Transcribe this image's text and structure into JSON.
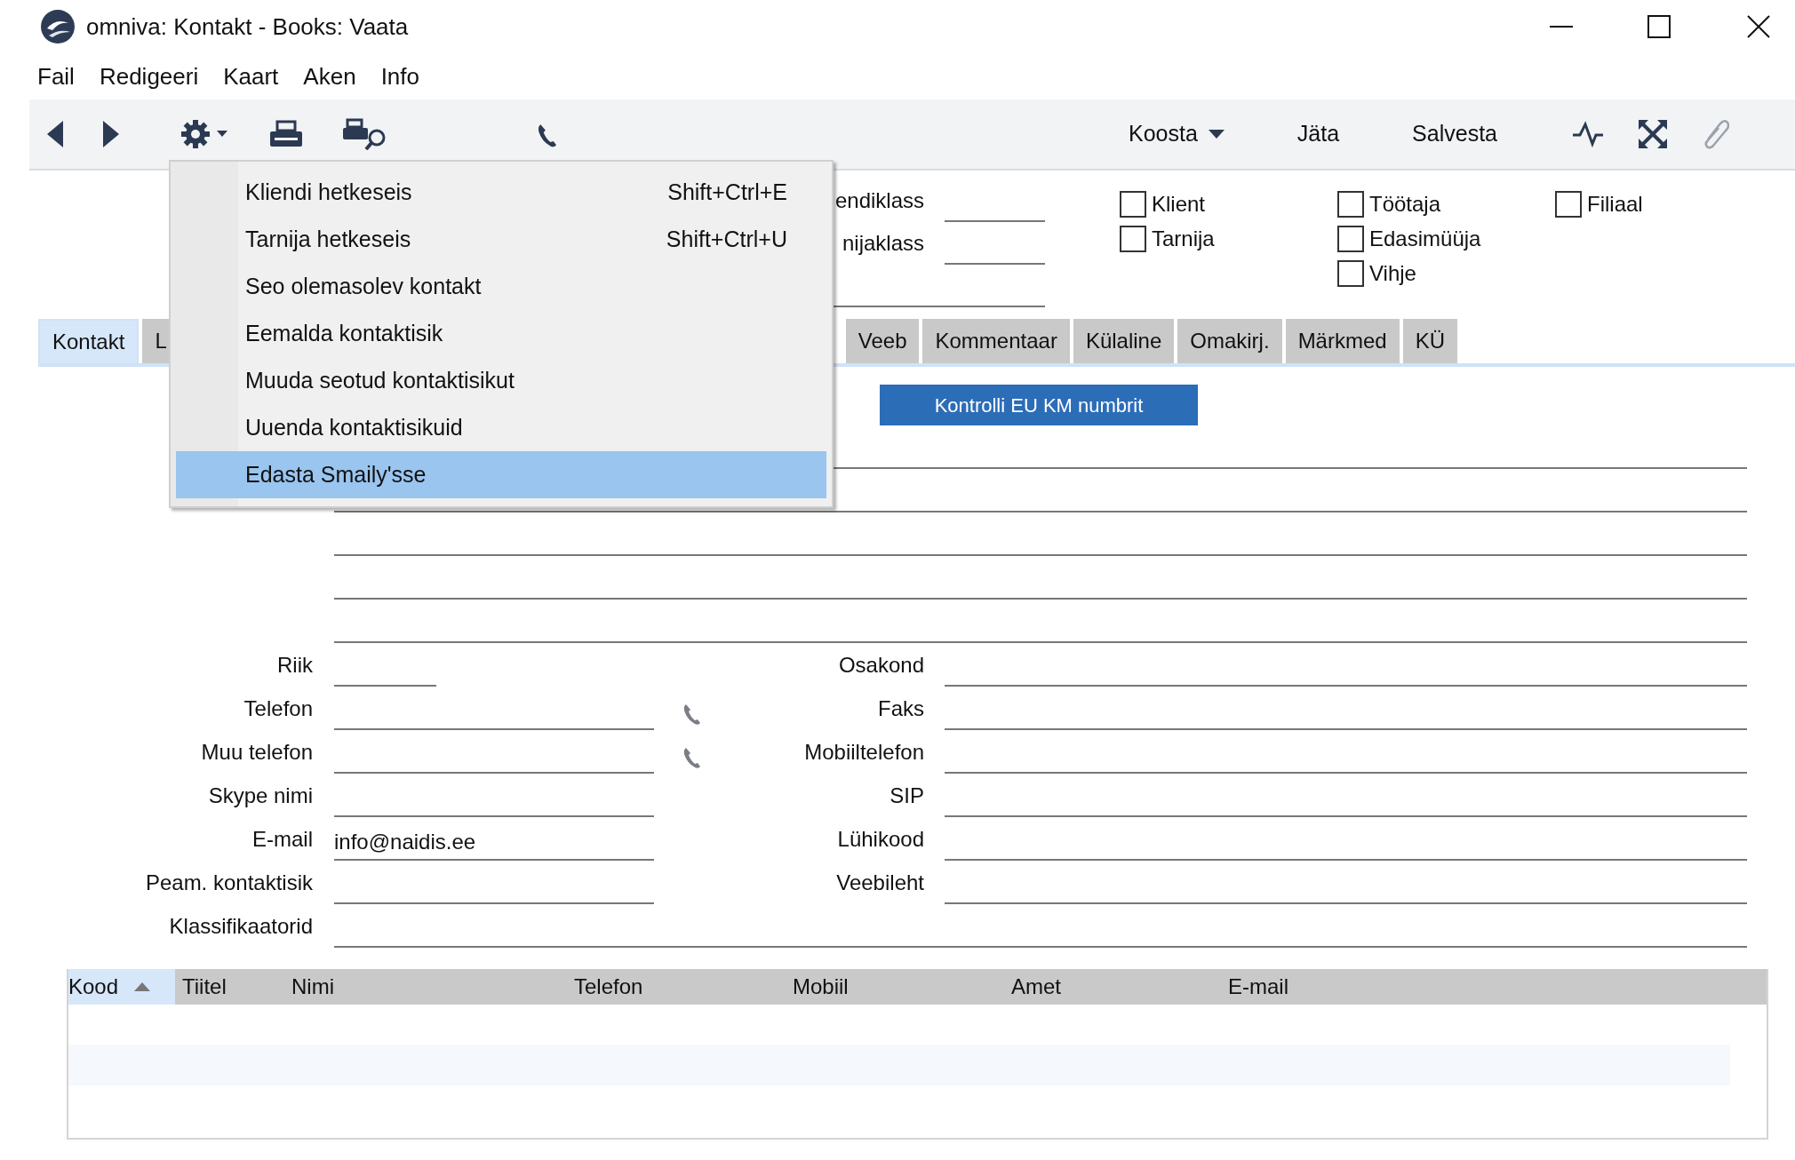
{
  "window": {
    "title": "omniva: Kontakt - Books: Vaata"
  },
  "menu_bar": [
    "Fail",
    "Redigeeri",
    "Kaart",
    "Aken",
    "Info"
  ],
  "toolbar": {
    "buttons": [
      {
        "label": "Koosta",
        "kind": "dropdown"
      },
      {
        "label": "Jäta",
        "kind": "plain"
      },
      {
        "label": "Salvesta",
        "kind": "plain"
      }
    ]
  },
  "context_menu": [
    {
      "label": "Kliendi hetkeseis",
      "shortcut": "Shift+Ctrl+E",
      "selected": false
    },
    {
      "label": "Tarnija hetkeseis",
      "shortcut": "Shift+Ctrl+U",
      "selected": false
    },
    {
      "label": "Seo olemasolev kontakt",
      "selected": false
    },
    {
      "label": "Eemalda kontaktisik",
      "selected": false
    },
    {
      "label": "Muuda seotud kontaktisikut",
      "selected": false
    },
    {
      "label": "Uuenda kontaktisikuid",
      "selected": false
    },
    {
      "label": "Edasta Smaily'sse",
      "selected": true
    }
  ],
  "class_fields": [
    {
      "label": "endiklass"
    },
    {
      "label": "nijaklass"
    },
    {
      "kind": "unlabelled"
    }
  ],
  "checkbox_columns": [
    {
      "items": [
        {
          "label": "Klient",
          "checked": false
        },
        {
          "label": "Tarnija",
          "checked": false
        }
      ]
    },
    {
      "items": [
        {
          "label": "Töötaja",
          "checked": false
        },
        {
          "label": "Edasimüüja",
          "checked": false
        },
        {
          "label": "Vihje",
          "checked": false
        }
      ]
    },
    {
      "items": [
        {
          "label": "Filiaal",
          "checked": false
        }
      ]
    }
  ],
  "tabs": [
    {
      "label": "Kontakt",
      "selected": true
    },
    {
      "label": "L",
      "selected": false
    },
    {
      "label": "Veeb",
      "selected": false
    },
    {
      "label": "Kommentaar",
      "selected": false
    },
    {
      "label": "Külaline",
      "selected": false
    },
    {
      "label": "Omakirj.",
      "selected": false
    },
    {
      "label": "Märkmed",
      "selected": false
    },
    {
      "label": "KÜ",
      "selected": false
    }
  ],
  "check_button": {
    "label": "Kontrolli EU KM numbrit"
  },
  "field_rows": [
    {
      "left": {
        "label": "Riik",
        "kind": "short"
      },
      "right": {
        "label": "Osakond"
      }
    },
    {
      "left": {
        "label": "Telefon",
        "phone_button": true
      },
      "right": {
        "label": "Faks"
      }
    },
    {
      "left": {
        "label": "Muu telefon",
        "phone_button": true
      },
      "right": {
        "label": "Mobiiltelefon"
      }
    },
    {
      "left": {
        "label": "Skype nimi"
      },
      "right": {
        "label": "SIP"
      }
    },
    {
      "left": {
        "label": "E-mail",
        "value": "info@naidis.ee"
      },
      "right": {
        "label": "Lühikood"
      }
    },
    {
      "left": {
        "label": "Peam. kontaktisik"
      },
      "right": {
        "label": "Veebileht"
      }
    }
  ],
  "classifier_field": {
    "label": "Klassifikaatorid"
  },
  "table": {
    "columns": [
      {
        "label": "Kood",
        "sorted": true
      },
      {
        "label": "Tiitel",
        "sorted": false
      },
      {
        "label": "Nimi",
        "sorted": false
      },
      {
        "label": "Telefon",
        "sorted": false
      },
      {
        "label": "Mobiil",
        "sorted": false
      },
      {
        "label": "Amet",
        "sorted": false
      },
      {
        "label": "E-mail",
        "sorted": false
      }
    ]
  }
}
